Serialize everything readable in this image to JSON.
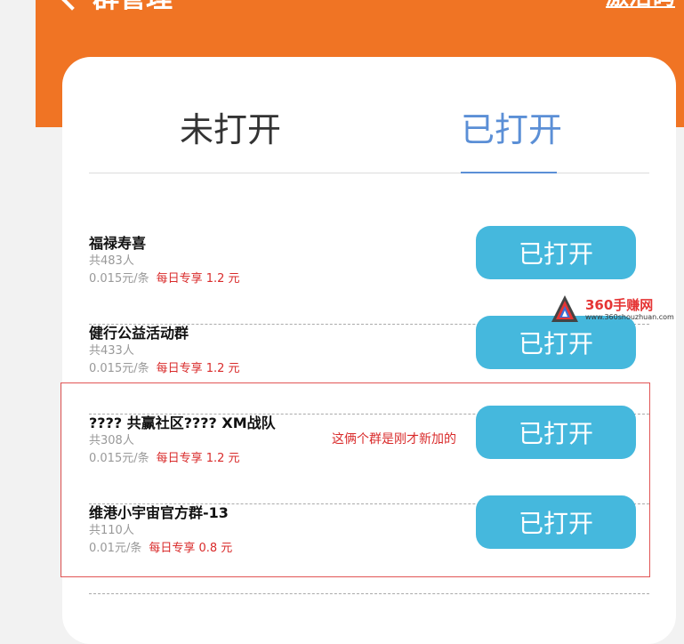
{
  "header": {
    "back_label": "群管理",
    "top_right_label": "激活码"
  },
  "tabs": [
    {
      "label": "未打开"
    },
    {
      "label": "已打开"
    }
  ],
  "groups": [
    {
      "name": "福禄寿喜",
      "members": "共483人",
      "price": "0.015元/条",
      "promo": "每日专享 1.2 元",
      "button": "已打开"
    },
    {
      "name": "健行公益活动群",
      "members": "共433人",
      "price": "0.015元/条",
      "promo": "每日专享 1.2 元",
      "button": "已打开"
    },
    {
      "name": "???? 共赢社区???? XM战队",
      "members": "共308人",
      "price": "0.015元/条",
      "promo": "每日专享 1.2 元",
      "button": "已打开"
    },
    {
      "name": "维港小宇宙官方群-13",
      "members": "共110人",
      "price": "0.01元/条",
      "promo": "每日专享 0.8 元",
      "button": "已打开"
    }
  ],
  "annotation": {
    "note": "这俩个群是刚才新加的"
  },
  "watermark": {
    "brand": "360手赚网",
    "url": "www.360shouzhuan.com"
  },
  "colors": {
    "header": "#f07424",
    "button": "#45b8dd",
    "active_tab": "#5b8fd6",
    "promo": "#d92b2b"
  }
}
